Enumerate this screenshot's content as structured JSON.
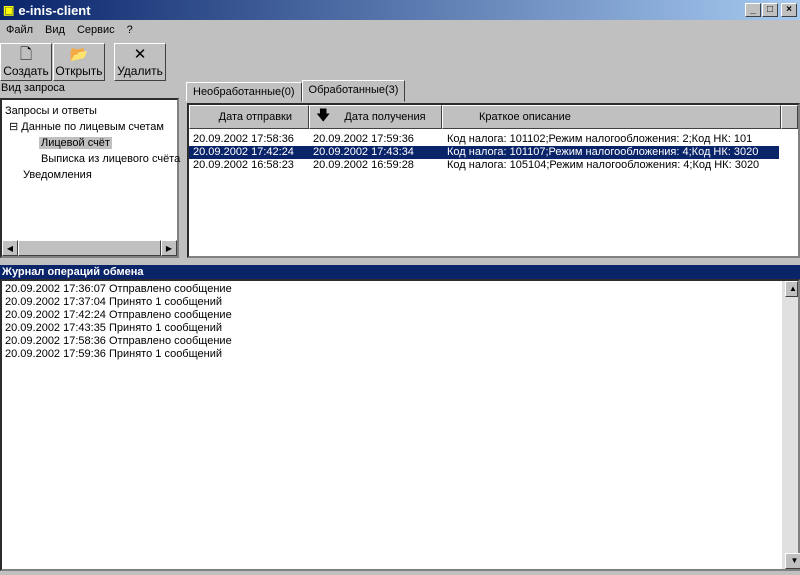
{
  "window": {
    "title": "e-inis-client",
    "minimize": "_",
    "maximize": "□",
    "close": "×"
  },
  "menu": [
    "Файл",
    "Вид",
    "Сервис",
    "?"
  ],
  "toolbar": [
    {
      "label": "Создать",
      "icon": "new-document-icon",
      "glyph": "🗋"
    },
    {
      "label": "Открыть",
      "icon": "open-folder-icon",
      "glyph": "📂"
    },
    {
      "label": "Удалить",
      "icon": "delete-x-icon",
      "glyph": "✕"
    }
  ],
  "left_panel": {
    "title": "Вид запроса",
    "tree": [
      {
        "label": "Запросы и ответы",
        "level": 0
      },
      {
        "label": "Данные по лицевым счетам",
        "level": 1,
        "expander": "⊟"
      },
      {
        "label": "Лицевой счёт",
        "level": 2,
        "selected": true
      },
      {
        "label": "Выписка из лицевого счёта",
        "level": 2
      },
      {
        "label": "Уведомления",
        "level": 1
      }
    ]
  },
  "tabs": [
    {
      "label": "Необработанные(0)"
    },
    {
      "label": "Обработанные(3)",
      "active": true
    }
  ],
  "table": {
    "columns": [
      "Дата отправки",
      "Дата получения",
      "Краткое описание"
    ],
    "sort_icon": "🡇",
    "rows": [
      [
        "20.09.2002 17:58:36",
        "20.09.2002 17:59:36",
        "Код налога: 101102;Режим налогообложения: 2;Код НК: 101"
      ],
      [
        "20.09.2002 17:42:24",
        "20.09.2002 17:43:34",
        "Код налога: 101107;Режим налогообложения: 4;Код НК: 3020"
      ],
      [
        "20.09.2002 16:58:23",
        "20.09.2002 16:59:28",
        "Код налога: 105104;Режим налогообложения: 4;Код НК: 3020"
      ]
    ],
    "selected_row": 1
  },
  "log": {
    "title": "Журнал операций обмена",
    "entries": [
      "20.09.2002 17:36:07 Отправлено сообщение",
      "20.09.2002 17:37:04 Принято 1 сообщений",
      "20.09.2002 17:42:24 Отправлено сообщение",
      "20.09.2002 17:43:35 Принято 1 сообщений",
      "20.09.2002 17:58:36 Отправлено сообщение",
      "20.09.2002 17:59:36 Принято 1 сообщений"
    ]
  }
}
